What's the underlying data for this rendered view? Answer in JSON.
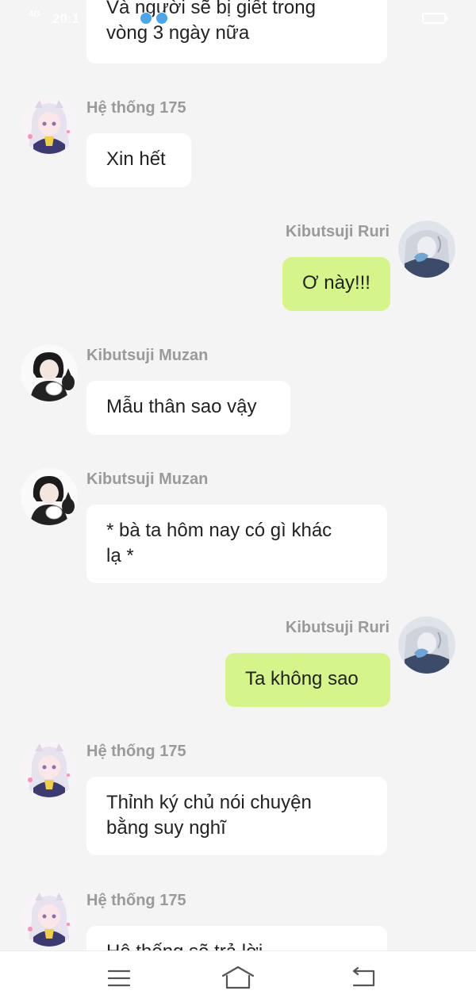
{
  "status_bar": {
    "signal": "4G",
    "time": "20:1",
    "battery": ""
  },
  "messages": [
    {
      "sender": "Hệ thống 175",
      "type": "in",
      "lines": [
        "Và người sẽ bị giết trong",
        "vòng 3 ngày nữa"
      ]
    },
    {
      "sender": "Hệ thống 175",
      "type": "in",
      "lines": [
        "Xin hết"
      ]
    },
    {
      "sender": "Kibutsuji Ruri",
      "type": "out",
      "lines": [
        "Ơ này!!!"
      ]
    },
    {
      "sender": "Kibutsuji Muzan",
      "type": "in",
      "lines": [
        "Mẫu thân sao vậy"
      ]
    },
    {
      "sender": "Kibutsuji Muzan",
      "type": "in",
      "lines": [
        "* bà ta hôm nay có gì khác",
        "lạ *"
      ]
    },
    {
      "sender": "Kibutsuji Ruri",
      "type": "out",
      "lines": [
        "Ta không sao"
      ]
    },
    {
      "sender": "Hệ thống 175",
      "type": "in",
      "lines": [
        "Thỉnh ký chủ nói chuyện",
        "bằng suy nghĩ"
      ]
    },
    {
      "sender": "Hệ thống 175",
      "type": "in",
      "lines": [
        "Hệ thống sẽ trả lời"
      ]
    }
  ],
  "avatars": {
    "system": "white-haired-girl-avatar",
    "muzan": "black-haired-man-with-cat-avatar",
    "ruri": "silver-haired-woman-avatar"
  },
  "nav_bar": {
    "menu": "menu-icon",
    "home": "home-icon",
    "back": "back-icon"
  },
  "colors": {
    "background": "#f4f4f4",
    "incoming_bubble": "#ffffff",
    "outgoing_bubble": "#d5f58a",
    "name": "#9a9a9a"
  }
}
